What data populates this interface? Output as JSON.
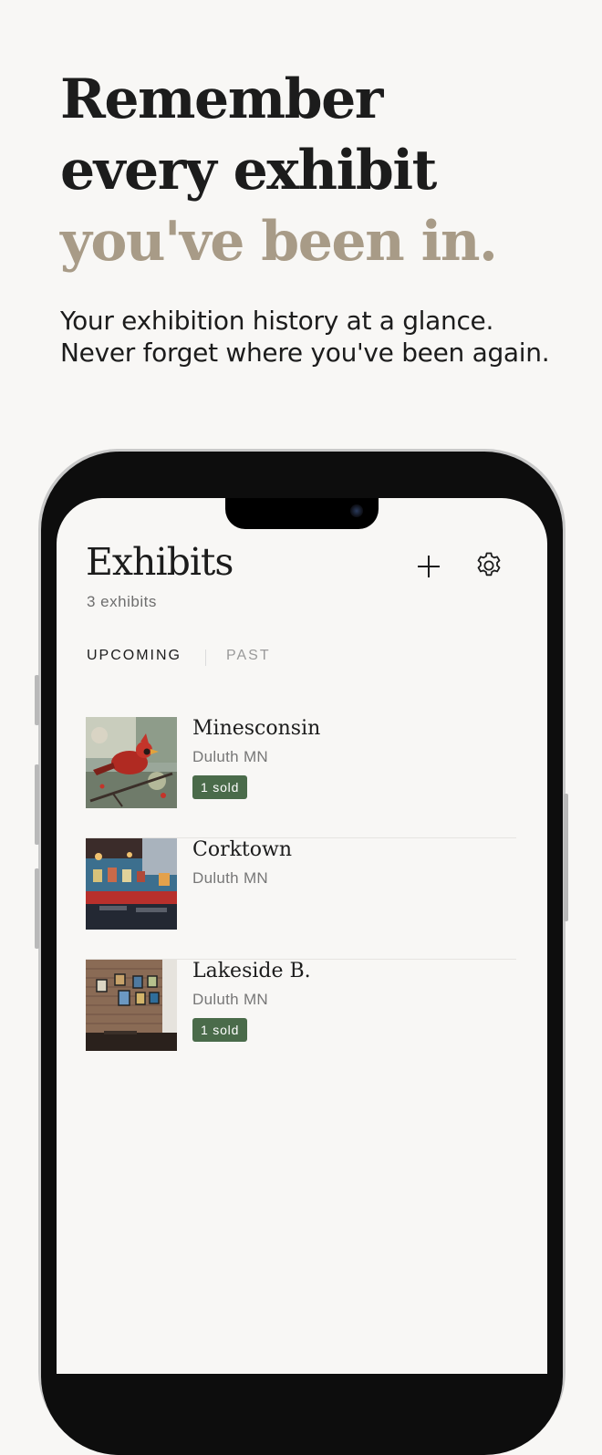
{
  "hero": {
    "line1": "Remember",
    "line2": "every exhibit",
    "line3": "you've been in.",
    "accent_color": "#a89b87"
  },
  "subtitle": {
    "line1": "Your exhibition history at a glance.",
    "line2": "Never forget where you've been again."
  },
  "app": {
    "title": "Exhibits",
    "count": "3 exhibits",
    "add_icon": "plus-icon",
    "settings_icon": "gear-icon",
    "tabs": [
      {
        "label": "UPCOMING",
        "active": true
      },
      {
        "label": "PAST",
        "active": false
      }
    ],
    "exhibits": [
      {
        "name": "Minesconsin",
        "location": "Duluth MN",
        "badge": "1 sold",
        "thumbnail": "cardinal-painting"
      },
      {
        "name": "Corktown",
        "location": "Duluth MN",
        "badge": "",
        "thumbnail": "restaurant-interior"
      },
      {
        "name": "Lakeside B.",
        "location": "Duluth MN",
        "badge": "1 sold",
        "thumbnail": "brick-wall-gallery"
      }
    ],
    "badge_color": "#4a6b4a"
  }
}
